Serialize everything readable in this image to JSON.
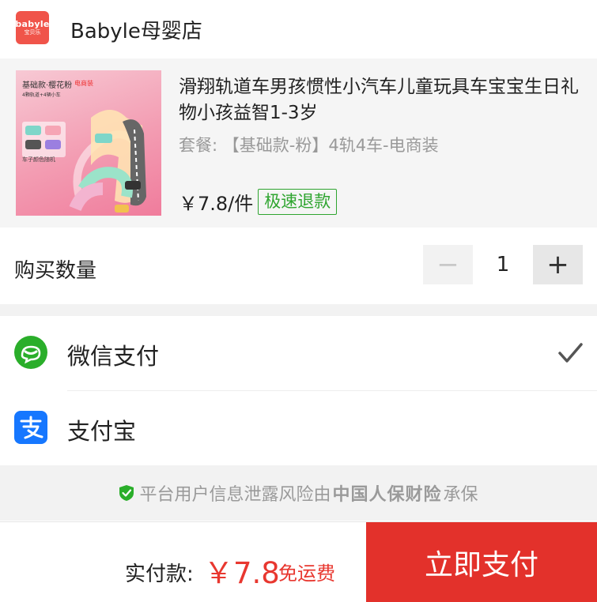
{
  "shop": {
    "logo_line1": "babyle",
    "logo_line2": "宝贝乐",
    "name": "Babyle母婴店"
  },
  "product": {
    "image_text1": "基础款·樱花粉",
    "image_badge": "电商装",
    "image_text2": "4颗轨道+4辆小车",
    "image_text3": "车子颜色随机",
    "title": "滑翔轨道车男孩惯性小汽车儿童玩具车宝宝生日礼物小孩益智1-3岁",
    "spec": "套餐: 【基础款-粉】4轨4车-电商装",
    "price": "￥7.8/件",
    "refund_badge": "极速退款"
  },
  "quantity": {
    "label": "购买数量",
    "minus": "−",
    "value": "1",
    "plus": "+"
  },
  "payment": {
    "wechat": {
      "label": "微信支付",
      "icon": "wechat-icon",
      "selected": true
    },
    "alipay": {
      "label": "支付宝",
      "icon": "alipay-icon",
      "selected": false
    }
  },
  "insurance": {
    "text_before": "平台用户信息泄露风险由",
    "brand": "中国人保财险",
    "text_after": "承保"
  },
  "checkout": {
    "total_label": "实付款:",
    "total_amount": "￥7.8",
    "shipping": "免运费",
    "pay_button": "立即支付"
  },
  "colors": {
    "accent_red": "#e3312b",
    "wechat_green": "#2aae2a",
    "alipay_blue": "#1677ff",
    "refund_green": "#2fa530"
  }
}
